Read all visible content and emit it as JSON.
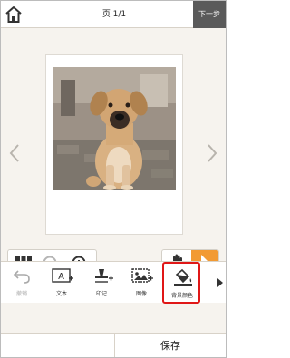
{
  "header": {
    "page_indicator": "页 1/1",
    "next_label": "下一步",
    "home_icon": "home-icon"
  },
  "canvas": {
    "prev_icon": "chevron-left-icon",
    "next_icon": "chevron-right-icon",
    "photo_subject": "puppy-photo"
  },
  "zoom_toolbar": {
    "grid_icon": "grid-icon",
    "zoom_out_icon": "zoom-out-icon",
    "zoom_in_icon": "zoom-in-icon"
  },
  "mode_toolbar": {
    "hand_icon": "hand-icon",
    "pointer_icon": "pointer-icon",
    "active_color": "#f29a33"
  },
  "tools": [
    {
      "label": "撤销",
      "icon": "undo-icon",
      "disabled": true
    },
    {
      "label": "文本",
      "icon": "text-icon",
      "disabled": false
    },
    {
      "label": "印记",
      "icon": "stamp-icon",
      "disabled": false
    },
    {
      "label": "图像",
      "icon": "image-icon",
      "disabled": false
    },
    {
      "label": "背景颜色",
      "icon": "background-color-icon",
      "disabled": false,
      "highlighted": true
    }
  ],
  "bottom": {
    "save_label": "保存"
  },
  "colors": {
    "header_next_bg": "#5a5a5a",
    "canvas_bg": "#f6f3ee",
    "highlight_border": "#e01717"
  }
}
